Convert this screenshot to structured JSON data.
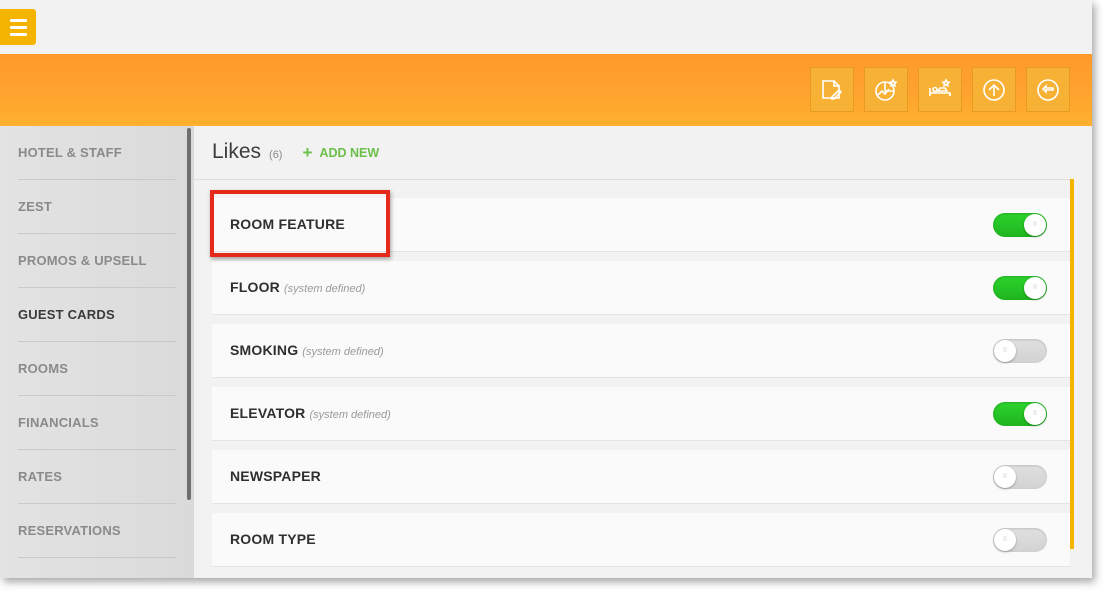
{
  "app": {
    "accent": "#ffa22e",
    "toggle_on_color": "#22c022",
    "highlight_color": "#e52a1a"
  },
  "menu_button": {
    "icon": "hamburger-icon"
  },
  "toolbar": {
    "icons": [
      "document-edit-icon",
      "star-chart-icon",
      "bed-star-icon",
      "upload-icon",
      "exit-icon"
    ]
  },
  "sidebar": {
    "items": [
      {
        "label": "HOTEL & STAFF",
        "active": false
      },
      {
        "label": "ZEST",
        "active": false
      },
      {
        "label": "PROMOS & UPSELL",
        "active": false
      },
      {
        "label": "GUEST CARDS",
        "active": true
      },
      {
        "label": "ROOMS",
        "active": false
      },
      {
        "label": "FINANCIALS",
        "active": false
      },
      {
        "label": "RATES",
        "active": false
      },
      {
        "label": "RESERVATIONS",
        "active": false
      }
    ]
  },
  "main": {
    "title": "Likes",
    "count": "(6)",
    "add_new_label": "ADD NEW",
    "rows": [
      {
        "label": "ROOM FEATURE",
        "note": "",
        "enabled": true
      },
      {
        "label": "FLOOR",
        "note": "(system defined)",
        "enabled": true
      },
      {
        "label": "SMOKING",
        "note": "(system defined)",
        "enabled": false
      },
      {
        "label": "ELEVATOR",
        "note": "(system defined)",
        "enabled": true
      },
      {
        "label": "NEWSPAPER",
        "note": "",
        "enabled": false
      },
      {
        "label": "ROOM TYPE",
        "note": "",
        "enabled": false
      }
    ]
  }
}
